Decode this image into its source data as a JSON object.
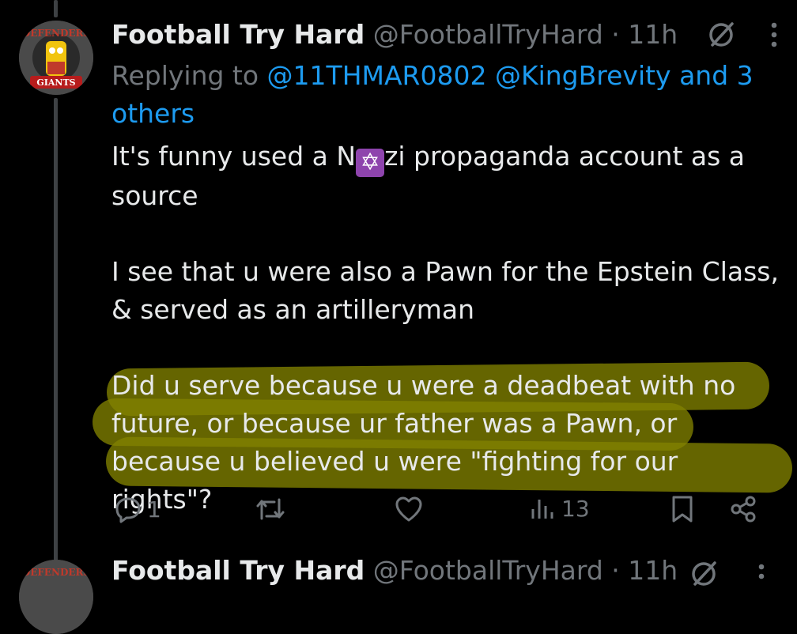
{
  "tweet": {
    "author_name": "Football Try Hard",
    "handle": "@FootballTryHard",
    "separator": "·",
    "time": "11h",
    "replying_prefix": "Replying to",
    "replying_mentions": "@11THMAR0802 @KingBrevity and 3 others",
    "text_line1_pre": "It's funny used a N",
    "text_line1_emoji": "✡",
    "text_line1_post": "zi propaganda account as a source",
    "text_para2": "I see that u were also a Pawn for the Epstein Class, & served as an artilleryman",
    "text_para3": "Did u serve because u were a deadbeat with no future, or because ur father was a Pawn, or because u believed u were \"fighting for our rights\"?",
    "reply_count": "1",
    "retweet_count": "",
    "like_count": "",
    "view_count": "13"
  },
  "next_tweet": {
    "author_name": "Football Try Hard",
    "handle": "@FootballTryHard",
    "separator": "·",
    "time": "11h"
  },
  "avatar": {
    "text_top": "DEFENDERS",
    "text_bottom": "GIANTS"
  },
  "icons": {
    "grok": "slashed-circle-icon",
    "more": "more-vertical-icon",
    "reply": "reply-bubble-icon",
    "retweet": "retweet-icon",
    "like": "heart-icon",
    "views": "views-bar-chart-icon",
    "bookmark": "bookmark-icon",
    "share": "share-icon"
  },
  "colors": {
    "background": "#000000",
    "text": "#e7e9ea",
    "muted": "#71767b",
    "link": "#1d9bf0",
    "highlight": "#828200"
  }
}
